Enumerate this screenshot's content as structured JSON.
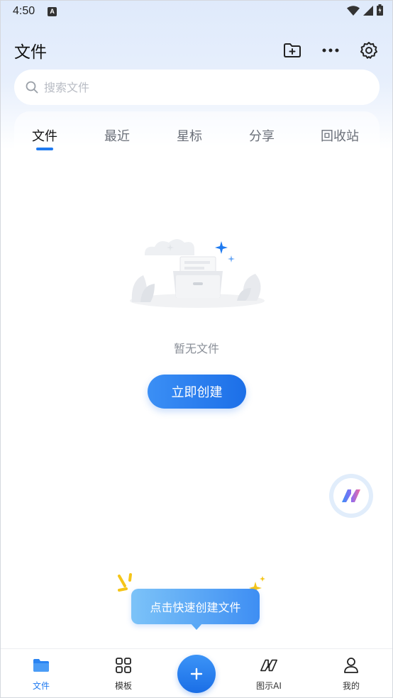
{
  "status_bar": {
    "time": "4:50",
    "notification_icon": "a-badge-icon",
    "icons": [
      "wifi-icon",
      "signal-icon",
      "battery-icon"
    ]
  },
  "header": {
    "title": "文件",
    "actions": [
      "new-folder-icon",
      "more-icon",
      "settings-icon"
    ]
  },
  "search": {
    "placeholder": "搜索文件",
    "value": ""
  },
  "tabs": [
    {
      "label": "文件",
      "active": true
    },
    {
      "label": "最近",
      "active": false
    },
    {
      "label": "星标",
      "active": false
    },
    {
      "label": "分享",
      "active": false
    },
    {
      "label": "回收站",
      "active": false
    }
  ],
  "empty_state": {
    "text": "暂无文件",
    "button_label": "立即创建"
  },
  "tooltip": {
    "text": "点击快速创建文件"
  },
  "bottom_nav": {
    "items": [
      {
        "label": "文件",
        "icon": "folder-icon",
        "active": true
      },
      {
        "label": "模板",
        "icon": "grid-icon",
        "active": false
      },
      {
        "label": "图示AI",
        "icon": "ai-logo-icon",
        "active": false
      },
      {
        "label": "我的",
        "icon": "user-icon",
        "active": false
      }
    ],
    "add_icon": "plus-icon"
  },
  "colors": {
    "accent": "#1f7af0",
    "header_bg": "#dfeafb",
    "muted_text": "#8a8f98"
  }
}
